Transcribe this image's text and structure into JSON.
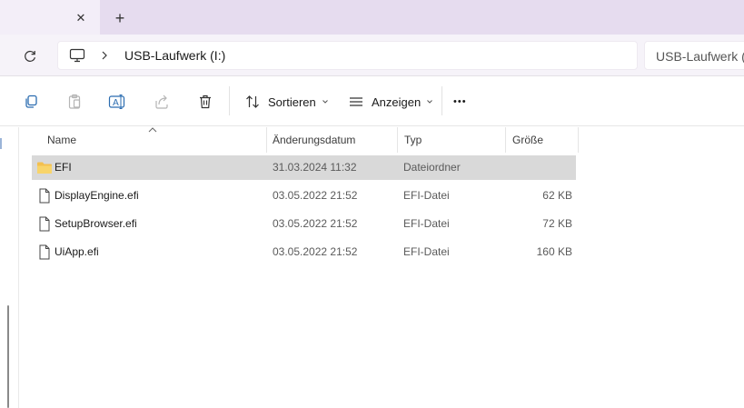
{
  "window": {
    "new_tab_symbol": "+",
    "close_tab_symbol": "✕"
  },
  "address": {
    "crumbs": [
      "USB-Laufwerk (I:)"
    ],
    "search_placeholder": "USB-Laufwerk (I:)"
  },
  "toolbar": {
    "sort_label": "Sortieren",
    "view_label": "Anzeigen",
    "more_label": "•••"
  },
  "columns": {
    "name": "Name",
    "date": "Änderungsdatum",
    "type": "Typ",
    "size": "Größe"
  },
  "files": [
    {
      "name": "EFI",
      "date": "31.03.2024 11:32",
      "type": "Dateiordner",
      "size": "",
      "icon": "folder-icon",
      "selected": true
    },
    {
      "name": "DisplayEngine.efi",
      "date": "03.05.2022 21:52",
      "type": "EFI-Datei",
      "size": "62 KB",
      "icon": "file-icon",
      "selected": false
    },
    {
      "name": "SetupBrowser.efi",
      "date": "03.05.2022 21:52",
      "type": "EFI-Datei",
      "size": "72 KB",
      "icon": "file-icon",
      "selected": false
    },
    {
      "name": "UiApp.efi",
      "date": "03.05.2022 21:52",
      "type": "EFI-Datei",
      "size": "160 KB",
      "icon": "file-icon",
      "selected": false
    }
  ],
  "colors": {
    "tab_strip": "#e6dcef",
    "selection": "#d9d9d9",
    "folder": "#f3c04f"
  }
}
